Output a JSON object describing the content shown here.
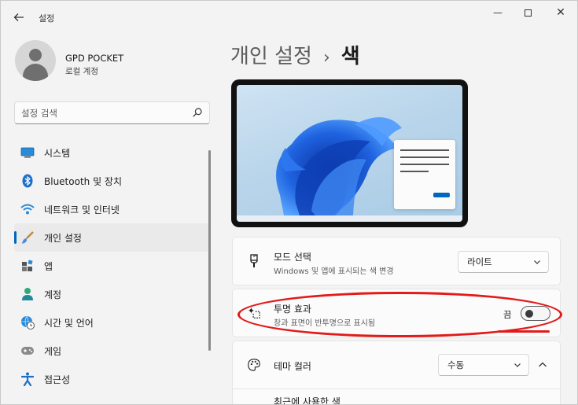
{
  "window": {
    "title": "설정",
    "minimize": "—",
    "close": "✕"
  },
  "profile": {
    "name": "GPD POCKET",
    "account_type": "로컬 계정"
  },
  "search": {
    "placeholder": "설정 검색"
  },
  "sidebar": {
    "items": [
      {
        "label": "시스템",
        "icon": "monitor-icon"
      },
      {
        "label": "Bluetooth 및 장치",
        "icon": "bluetooth-icon"
      },
      {
        "label": "네트워크 및 인터넷",
        "icon": "wifi-icon"
      },
      {
        "label": "개인 설정",
        "icon": "brush-icon",
        "active": true
      },
      {
        "label": "앱",
        "icon": "apps-icon"
      },
      {
        "label": "계정",
        "icon": "person-icon"
      },
      {
        "label": "시간 및 언어",
        "icon": "globe-clock-icon"
      },
      {
        "label": "게임",
        "icon": "gamepad-icon"
      },
      {
        "label": "접근성",
        "icon": "accessibility-icon"
      }
    ]
  },
  "header": {
    "parent": "개인 설정",
    "separator": "›",
    "current": "색"
  },
  "settings": {
    "mode": {
      "title": "모드 선택",
      "description": "Windows 및 앱에 표시되는 색 변경",
      "value": "라이트"
    },
    "transparency": {
      "title": "투명 효과",
      "description": "창과 표면이 반투명으로 표시됨",
      "state_label": "끔",
      "enabled": false
    },
    "accent": {
      "title": "테마 컬러",
      "value": "수동"
    },
    "recent_colors": {
      "title": "최근에 사용한 색"
    }
  },
  "colors": {
    "accent": "#0067c0",
    "annotation": "#e21a1a"
  }
}
